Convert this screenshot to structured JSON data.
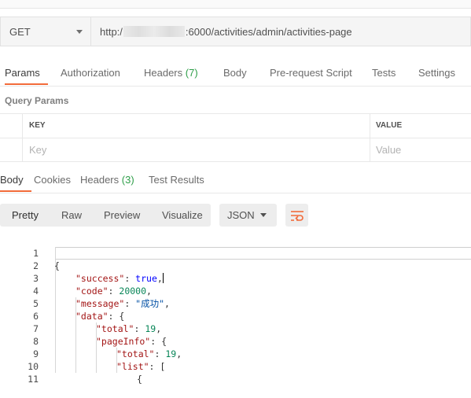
{
  "request": {
    "method": "GET",
    "url_prefix": "http:/",
    "url_suffix": ":6000/activities/admin/activities-page"
  },
  "request_tabs": {
    "params": "Params",
    "authorization": "Authorization",
    "headers": "Headers",
    "headers_count": "(7)",
    "body": "Body",
    "prerequest": "Pre-request Script",
    "tests": "Tests",
    "settings": "Settings"
  },
  "query_params": {
    "title": "Query Params",
    "key_header": "KEY",
    "value_header": "VALUE",
    "key_placeholder": "Key",
    "value_placeholder": "Value"
  },
  "response_tabs": {
    "body": "Body",
    "cookies": "Cookies",
    "headers": "Headers",
    "headers_count": "(3)",
    "test_results": "Test Results"
  },
  "toolbar": {
    "pretty": "Pretty",
    "raw": "Raw",
    "preview": "Preview",
    "visualize": "Visualize",
    "format": "JSON",
    "wrap_icon": "wrap-lines-icon",
    "accent_color": "#f26b3a"
  },
  "code": {
    "line_numbers": [
      "1",
      "2",
      "3",
      "4",
      "5",
      "6",
      "7",
      "8",
      "9",
      "10",
      "11"
    ],
    "l1": "{",
    "l2_key": "\"success\"",
    "l2_val": "true",
    "l3_key": "\"code\"",
    "l3_val": "20000",
    "l4_key": "\"message\"",
    "l4_val": "\"成功\"",
    "l5_key": "\"data\"",
    "l6_key": "\"total\"",
    "l6_val": "19",
    "l7_key": "\"pageInfo\"",
    "l8_key": "\"total\"",
    "l8_val": "19",
    "l9_key": "\"list\"",
    "l10": "{"
  }
}
